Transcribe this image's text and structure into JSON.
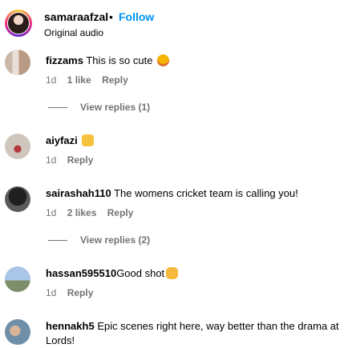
{
  "header": {
    "username": "samaraafzal",
    "separator": "•",
    "follow_label": "Follow",
    "subtitle": "Original audio"
  },
  "comments": [
    {
      "username": "fizzams",
      "text": "This is so cute",
      "emoji": "star-struck-emoji",
      "age": "1d",
      "likes": "1 like",
      "reply_label": "Reply",
      "view_replies": "View replies (1)"
    },
    {
      "username": "aiyfazi",
      "text": "",
      "emoji": "raised-hands-emoji",
      "age": "1d",
      "likes": "",
      "reply_label": "Reply",
      "view_replies": ""
    },
    {
      "username": "sairashah110",
      "text": "The womens cricket team is calling you!",
      "emoji": "",
      "age": "1d",
      "likes": "2 likes",
      "reply_label": "Reply",
      "view_replies": "View replies (2)"
    },
    {
      "username": "hassan595510",
      "text": "Good shot",
      "emoji": "clapping-hands-emoji",
      "age": "1d",
      "likes": "",
      "reply_label": "Reply",
      "view_replies": ""
    },
    {
      "username": "hennakh5",
      "text": "Epic scenes right here, way better than the drama at Lords!",
      "emoji": "",
      "age": "",
      "likes": "",
      "reply_label": "",
      "view_replies": ""
    }
  ],
  "colors": {
    "follow": "#0095f6",
    "meta": "#737373"
  }
}
